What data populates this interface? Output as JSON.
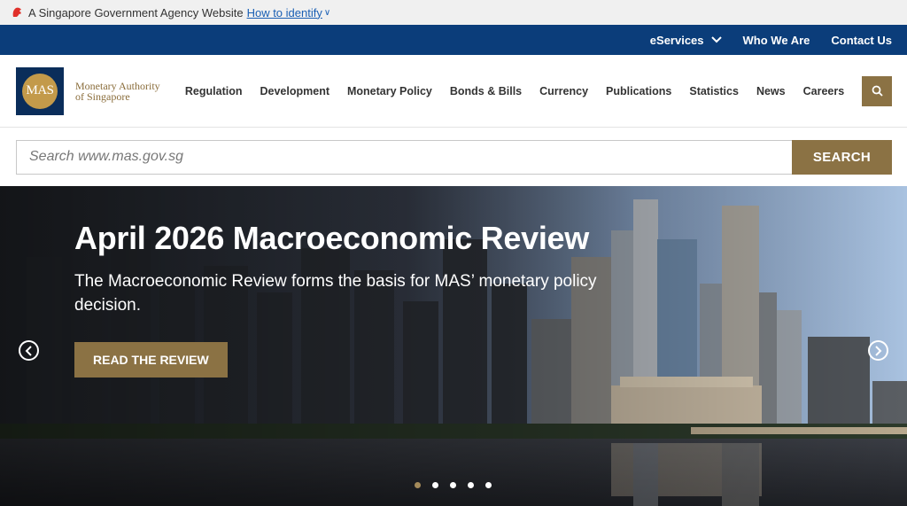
{
  "gov_banner": {
    "text": "A Singapore Government Agency Website",
    "link": "How to identify"
  },
  "util_nav": {
    "items": [
      {
        "label": "eServices",
        "has_dropdown": true
      },
      {
        "label": "Who We Are"
      },
      {
        "label": "Contact Us"
      }
    ]
  },
  "logo": {
    "mark": "MAS",
    "line1": "Monetary Authority",
    "line2": "of Singapore"
  },
  "main_nav": {
    "items": [
      "Regulation",
      "Development",
      "Monetary Policy",
      "Bonds & Bills",
      "Currency",
      "Publications",
      "Statistics",
      "News",
      "Careers"
    ]
  },
  "search": {
    "placeholder": "Search www.mas.gov.sg",
    "button_label": "SEARCH"
  },
  "hero": {
    "title": "April 2026 Macroeconomic Review",
    "description": "The Macroeconomic Review forms the basis for MAS’ monetary policy decision.",
    "cta_label": "READ THE REVIEW",
    "slide_count": 5,
    "active_slide": 1
  },
  "colors": {
    "gov_banner_bg": "#f0f0f0",
    "util_bar_bg": "#0b3d7a",
    "brand_navy": "#0a2d5a",
    "brand_gold": "#8b7244",
    "logo_gold": "#c39a4a"
  }
}
